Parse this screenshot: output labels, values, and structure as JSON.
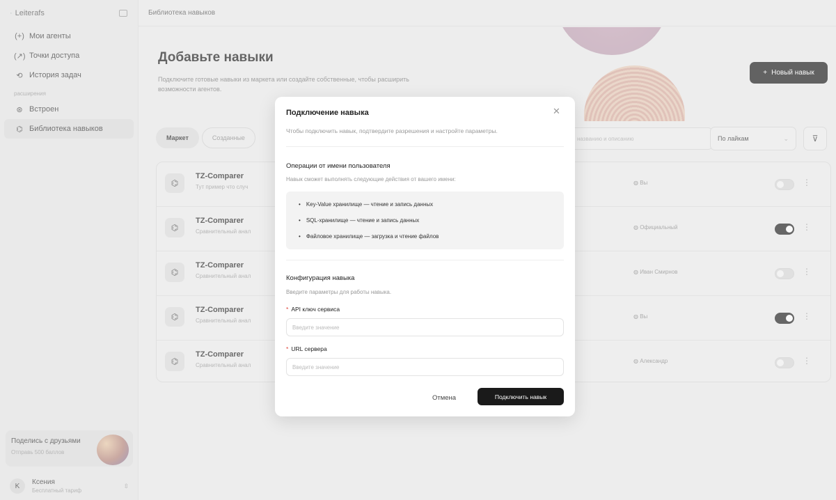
{
  "brand": {
    "name": "Leiterafs"
  },
  "sidebar": {
    "items": [
      {
        "icon": "(+)",
        "label": "Мои агенты"
      },
      {
        "icon": "(↗)",
        "label": "Точки доступа"
      },
      {
        "icon": "⟲",
        "label": "История задач"
      }
    ],
    "section_label": "расширения",
    "ext_items": [
      {
        "icon": "⊛",
        "label": "Встроен"
      },
      {
        "icon": "⌬",
        "label": "Библиотека навыков"
      }
    ],
    "share": {
      "title": "Поделись с друзьями",
      "sub": "Отправь 500 баллов"
    },
    "user": {
      "avatar": "K",
      "name": "Ксения",
      "plan": "Бесплатный тариф"
    }
  },
  "topbar": {
    "breadcrumb": "Библиотека навыков"
  },
  "hero": {
    "title": "Добавьте навыки",
    "subtitle": "Подключите готовые навыки из маркета или создайте собственные, чтобы расширить возможности агентов.",
    "new_button": "Новый навык"
  },
  "filters": {
    "tabs": [
      "Маркет",
      "Созданные"
    ],
    "search_placeholder": "названию и описанию",
    "sort_value": "По лайкам"
  },
  "skills": [
    {
      "title": "TZ-Comparer",
      "desc": "Тут пример что случ",
      "author": "Вы",
      "enabled": false
    },
    {
      "title": "TZ-Comparer",
      "desc": "Сравнительный анал",
      "author": "Официальный",
      "enabled": true
    },
    {
      "title": "TZ-Comparer",
      "desc": "Сравнительный анал",
      "author": "Иван Смирнов",
      "enabled": false
    },
    {
      "title": "TZ-Comparer",
      "desc": "Сравнительный анал",
      "author": "Вы",
      "enabled": true
    },
    {
      "title": "TZ-Comparer",
      "desc": "Сравнительный анал",
      "author": "Александр",
      "enabled": false
    }
  ],
  "modal": {
    "title": "Подключение навыка",
    "subtitle": "Чтобы подключить навык, подтвердите разрешения и настройте параметры.",
    "ops_title": "Операции от имени пользователя",
    "ops_sub": "Навык сможет выполнять следующие действия от вашего имени:",
    "permissions": [
      "Key-Value хранилище — чтение и запись данных",
      "SQL-хранилище — чтение и запись данных",
      "Файловое хранилище — загрузка и чтение файлов"
    ],
    "config_title": "Конфигурация навыка",
    "config_sub": "Введите параметры для работы навыка.",
    "fields": [
      {
        "label": "API ключ сервиса",
        "placeholder": "Введите значение"
      },
      {
        "label": "URL сервера",
        "placeholder": "Введите значение"
      }
    ],
    "cancel": "Отмена",
    "connect": "Подключить навык"
  }
}
